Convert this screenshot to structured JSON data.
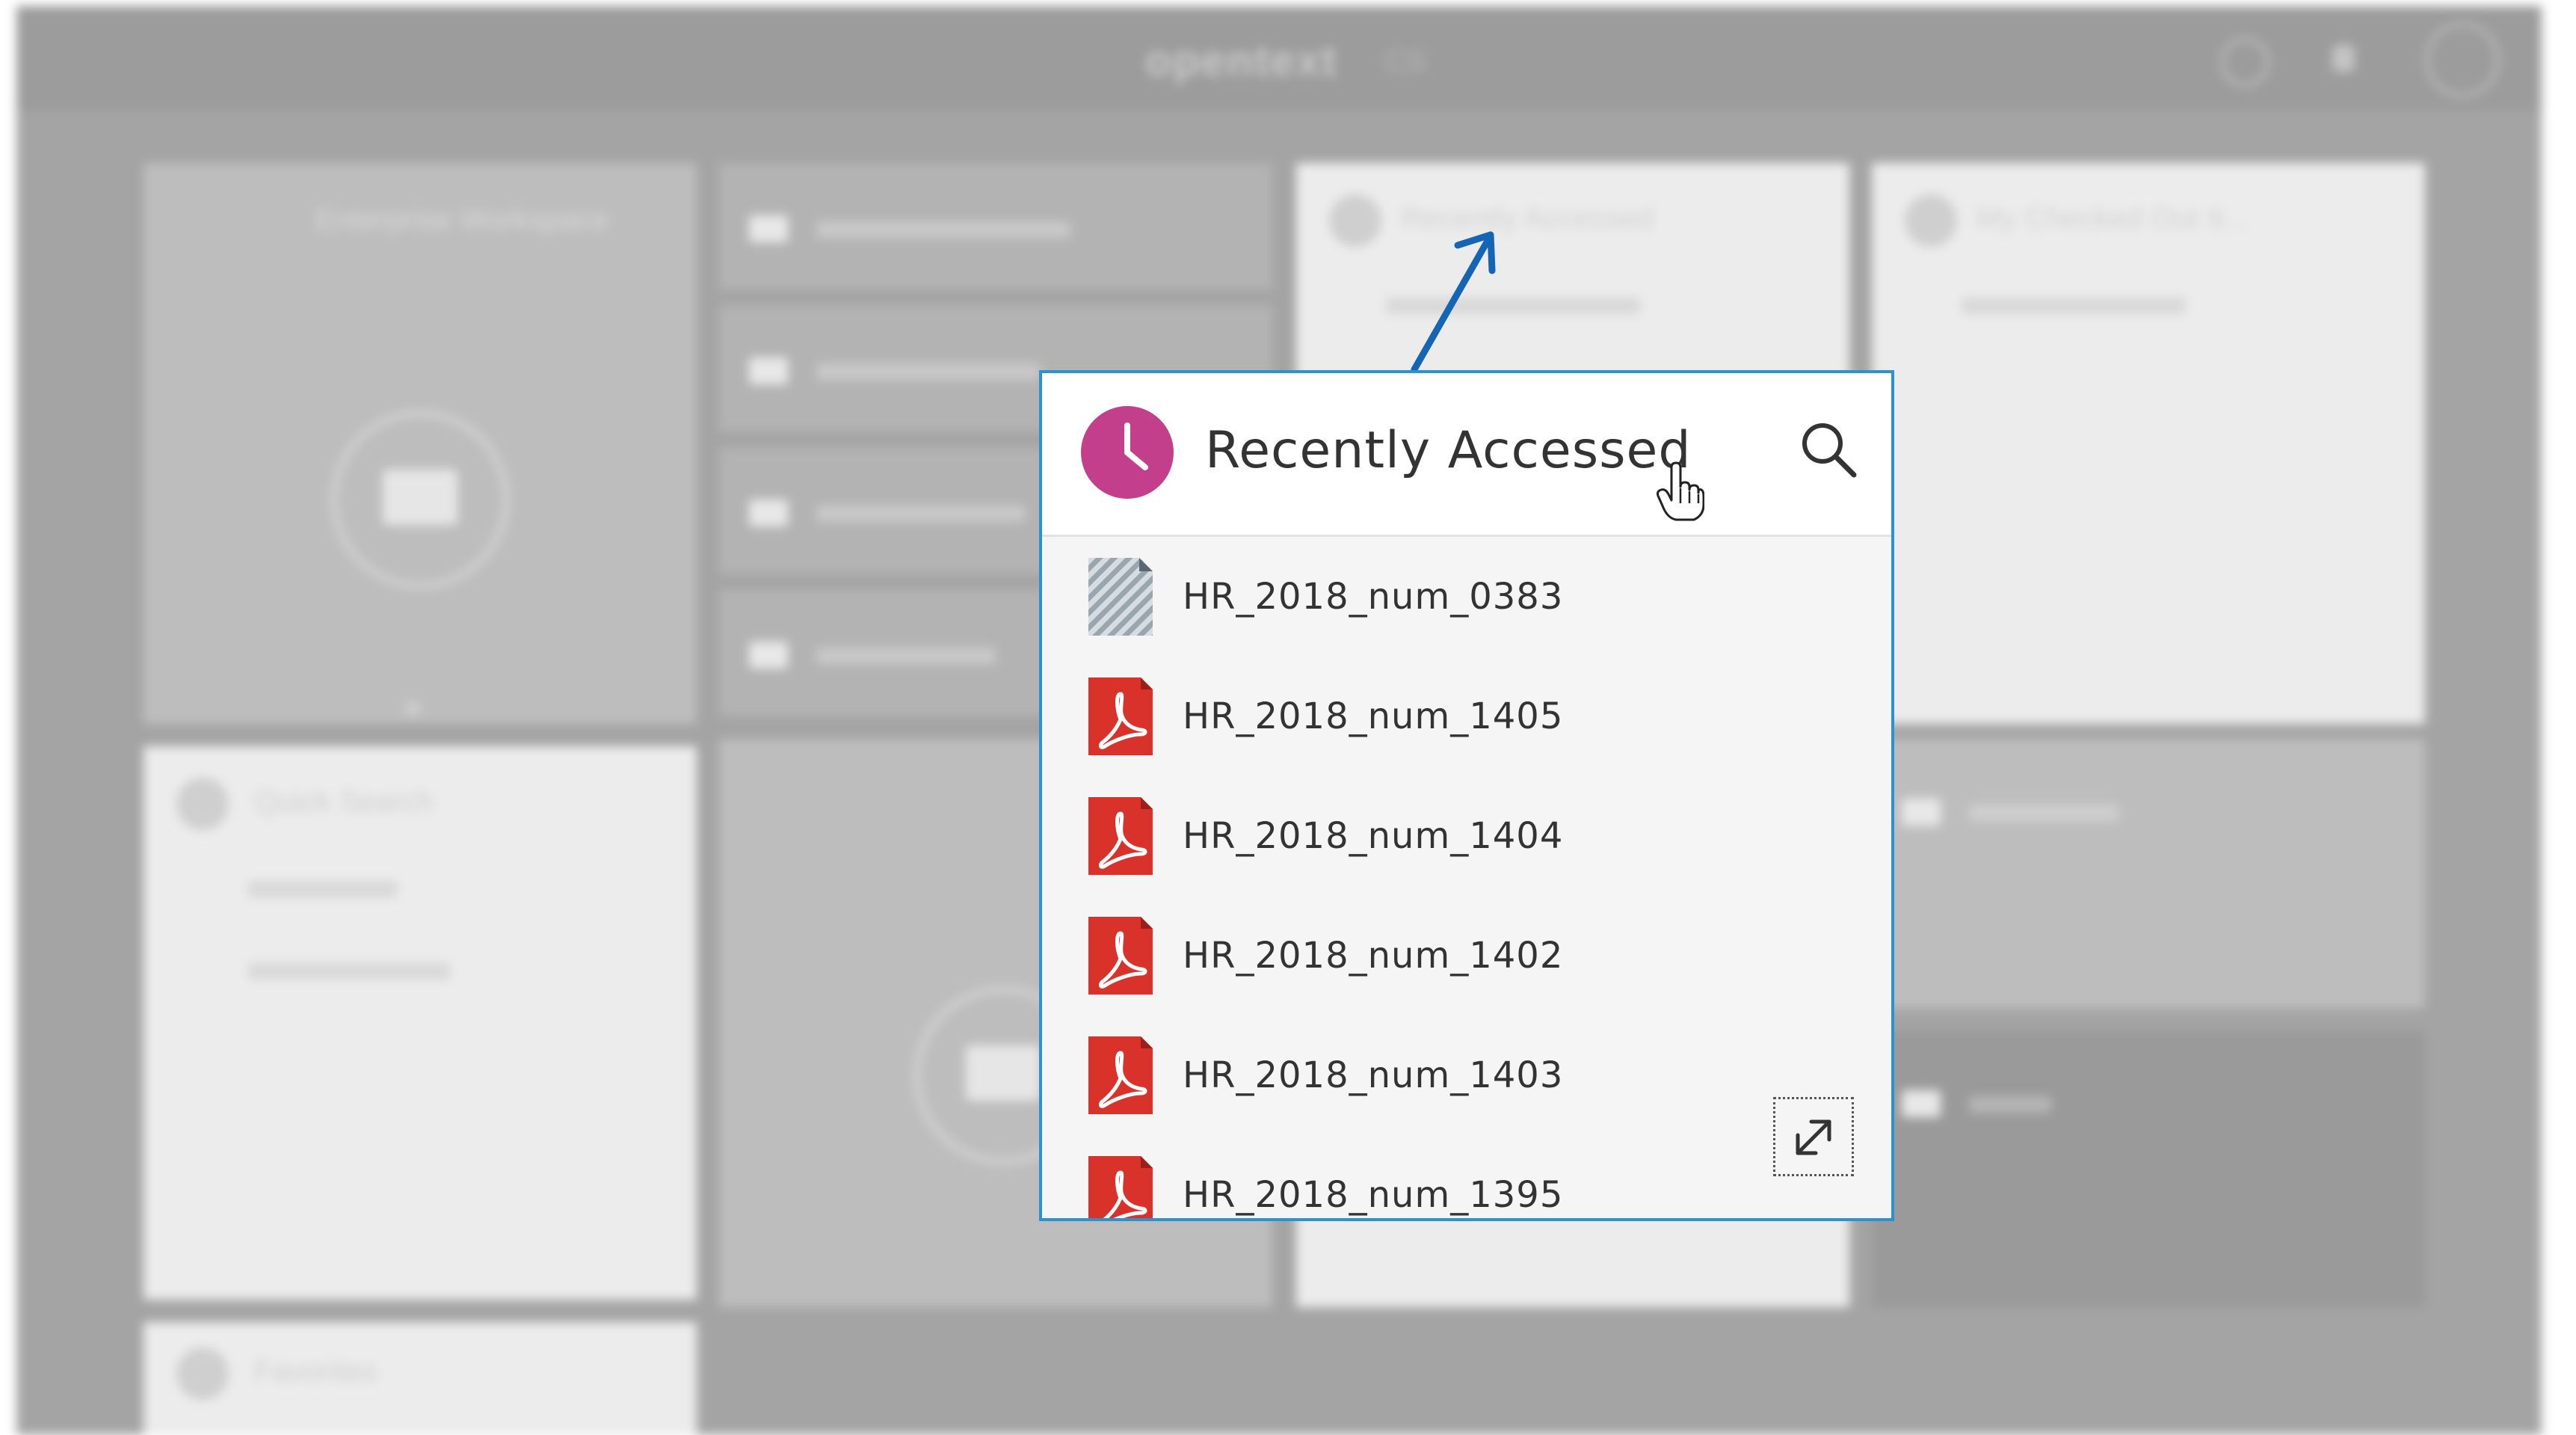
{
  "background": {
    "logo": "opentext",
    "logo_sub": "CS",
    "tiles": {
      "enterprise_workspace": "Enterprise Workspace",
      "quick_search": "Quick Search",
      "favorites": "Favorites",
      "recently_accessed_small": "Recently Accessed",
      "checked_out": "My Checked Out It..."
    }
  },
  "widget": {
    "title": "Recently Accessed",
    "accent_color": "#c43f8b",
    "border_color": "#2a93cf",
    "items": [
      {
        "name": "HR_2018_num_0383",
        "icon": "generic-document-icon"
      },
      {
        "name": "HR_2018_num_1405",
        "icon": "pdf-icon"
      },
      {
        "name": "HR_2018_num_1404",
        "icon": "pdf-icon"
      },
      {
        "name": "HR_2018_num_1402",
        "icon": "pdf-icon"
      },
      {
        "name": "HR_2018_num_1403",
        "icon": "pdf-icon"
      },
      {
        "name": "HR_2018_num_1395",
        "icon": "pdf-icon"
      }
    ]
  }
}
